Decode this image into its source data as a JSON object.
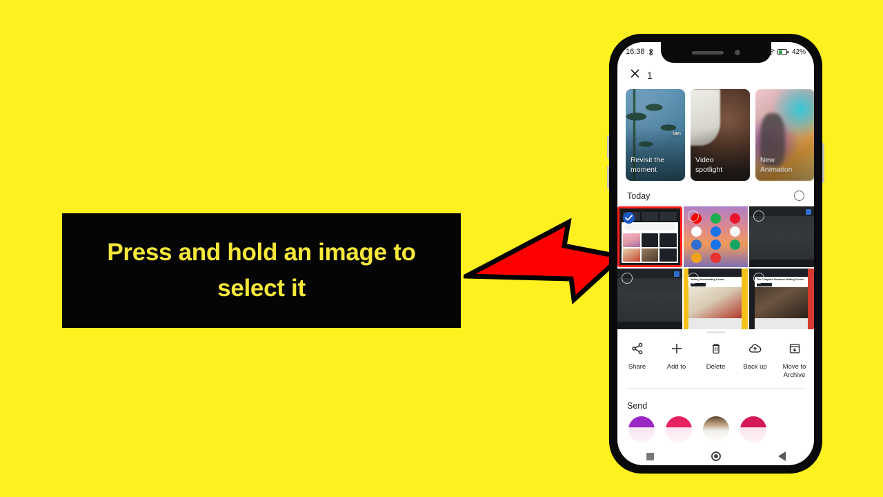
{
  "instruction": {
    "text": "Press and hold an image to select it"
  },
  "background_color": "#FFF01F",
  "arrow": {
    "name": "red-arrow",
    "color": "#FF0000",
    "outline": "#000000",
    "direction": "right"
  },
  "phone": {
    "status_bar": {
      "time": "16:38",
      "left_icon": "bluetooth-icon",
      "wifi_icon": "wifi-icon",
      "battery_icon": "battery-icon",
      "battery_level": "42%"
    },
    "selection_header": {
      "close_icon": "close-icon",
      "count": "1"
    },
    "memories": [
      {
        "label": "Revisit the\nmoment",
        "art": "card-palms",
        "hint": "lan"
      },
      {
        "label": "Video\nspotlight",
        "art": "card-video",
        "hint": ""
      },
      {
        "label": "New\nAnimation",
        "art": "card-anim",
        "hint": ""
      }
    ],
    "section": {
      "title": "Today",
      "select_all_icon": "empty-circle-icon"
    },
    "grid": [
      {
        "type": "browser-screenshot",
        "selected": true,
        "checked": true
      },
      {
        "type": "app-home-screen",
        "selected": false,
        "checked": false
      },
      {
        "type": "dark-post",
        "selected": false,
        "checked": false
      },
      {
        "type": "dark-post",
        "selected": false,
        "checked": false
      },
      {
        "type": "course-writing",
        "selected": false,
        "checked": false
      },
      {
        "type": "course-laptop",
        "selected": false,
        "checked": false
      }
    ],
    "actions": [
      {
        "label": "Share",
        "icon": "share-icon"
      },
      {
        "label": "Add to",
        "icon": "plus-icon"
      },
      {
        "label": "Delete",
        "icon": "trash-icon"
      },
      {
        "label": "Back up",
        "icon": "cloud-upload-icon"
      },
      {
        "label": "Move to\nArchive",
        "icon": "archive-icon"
      }
    ],
    "send": {
      "label": "Send",
      "avatars": [
        {
          "name": "avatar-purple",
          "color": "#9A27C4"
        },
        {
          "name": "avatar-pink",
          "color": "#E8215F"
        },
        {
          "name": "avatar-photo",
          "color": "#C6A98A"
        },
        {
          "name": "avatar-crimson",
          "color": "#D4195A"
        }
      ]
    },
    "nav_bar": {
      "recents_icon": "square-icon",
      "home_icon": "circle-icon",
      "back_icon": "triangle-back-icon"
    }
  }
}
